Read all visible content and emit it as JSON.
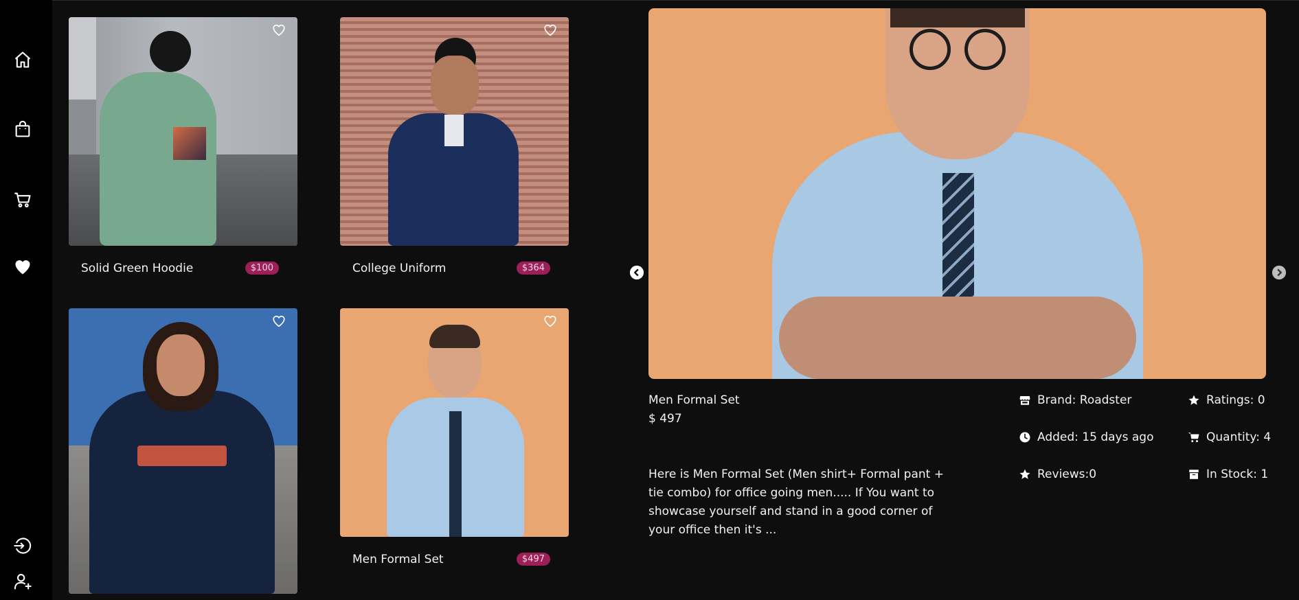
{
  "sidebar": {
    "items": [
      {
        "icon": "home-icon"
      },
      {
        "icon": "shopping-bag-icon"
      },
      {
        "icon": "cart-icon"
      },
      {
        "icon": "heart-icon"
      }
    ],
    "bottom": [
      {
        "icon": "logout-icon"
      },
      {
        "icon": "add-user-icon"
      }
    ]
  },
  "products": [
    {
      "name": "Solid Green Hoodie",
      "price": "$100"
    },
    {
      "name": "College Uniform",
      "price": "$364"
    },
    {
      "name": "",
      "price": ""
    },
    {
      "name": "Men Formal Set",
      "price": "$497"
    }
  ],
  "detail": {
    "name": "Men Formal Set",
    "price": "$ 497",
    "description": "Here is Men Formal Set (Men shirt+ Formal pant + tie combo) for office going men..... If You want to showcase yourself and stand in a good corner of your office then it's ...",
    "brand": "Brand: Roadster",
    "ratings": "Ratings: 0",
    "added": "Added: 15 days ago",
    "quantity": "Quantity: 4",
    "reviews": "Reviews:0",
    "in_stock": "In Stock: 1"
  },
  "colors": {
    "background": "#0e0e0e",
    "sidebar": "#000000",
    "price_badge": "#9c1f58"
  }
}
